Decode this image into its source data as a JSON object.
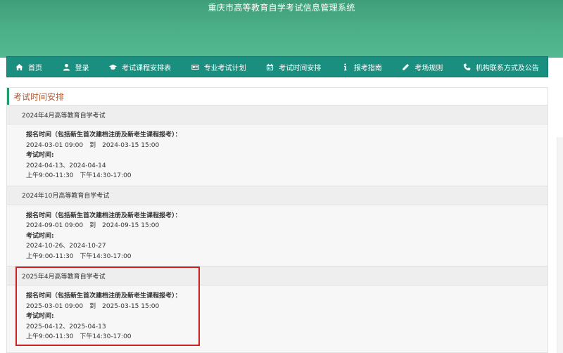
{
  "site": {
    "title": "重庆市高等教育自学考试信息管理系统"
  },
  "nav": [
    {
      "label": "首页",
      "icon": "home-icon"
    },
    {
      "label": "登录",
      "icon": "user-icon"
    },
    {
      "label": "考试课程安排表",
      "icon": "graduation-cap-icon"
    },
    {
      "label": "专业考试计划",
      "icon": "id-card-icon"
    },
    {
      "label": "考试时间安排",
      "icon": "calendar-icon"
    },
    {
      "label": "报考指南",
      "icon": "info-icon"
    },
    {
      "label": "考场规则",
      "icon": "pencil-icon"
    },
    {
      "label": "机构联系方式及公告",
      "icon": "phone-icon"
    }
  ],
  "panel": {
    "title": "考试时间安排"
  },
  "exams": [
    {
      "title": "2024年4月高等教育自学考试",
      "reg_label": "报名时间（包括新生首次建档注册及新老生课程报考）：",
      "reg_time": "2024-03-01 09:00　到　2024-03-15 15:00",
      "exam_label": "考试时间:",
      "exam_dates": "2024-04-13、2024-04-14",
      "exam_hours": "上午9:00-11:30　下午14:30-17:00"
    },
    {
      "title": "2024年10月高等教育自学考试",
      "reg_label": "报名时间（包括新生首次建档注册及新老生课程报考）：",
      "reg_time": "2024-09-01 09:00　到　2024-09-15 15:00",
      "exam_label": "考试时间:",
      "exam_dates": "2024-10-26、2024-10-27",
      "exam_hours": "上午9:00-11:30　下午14:30-17:00"
    },
    {
      "title": "2025年4月高等教育自学考试",
      "reg_label": "报名时间（包括新生首次建档注册及新老生课程报考）：",
      "reg_time": "2025-03-01 09:00　到　2025-03-15 15:00",
      "exam_label": "考试时间:",
      "exam_dates": "2025-04-12、2025-04-13",
      "exam_hours": "上午9:00-11:30　下午14:30-17:00"
    }
  ],
  "colors": {
    "nav_bg": "#1a8f80",
    "banner": "#4aae86",
    "panel_title": "#b05b33",
    "highlight": "#cc2222"
  }
}
